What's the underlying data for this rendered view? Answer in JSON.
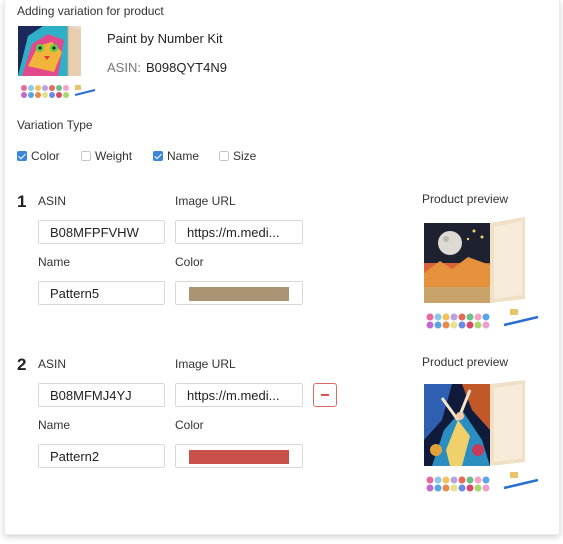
{
  "header": {
    "title": "Adding variation for product",
    "product_name": "Paint by Number Kit",
    "asin_label": "ASIN:",
    "asin_value": "B098QYT4N9",
    "image_icon": "cat-painting-thumbnail"
  },
  "variation_type": {
    "label": "Variation Type",
    "options": [
      {
        "label": "Color",
        "checked": true
      },
      {
        "label": "Weight",
        "checked": false
      },
      {
        "label": "Name",
        "checked": true
      },
      {
        "label": "Size",
        "checked": false
      }
    ]
  },
  "labels": {
    "asin": "ASIN",
    "image_url": "Image URL",
    "name": "Name",
    "color": "Color",
    "product_preview": "Product preview"
  },
  "variations": [
    {
      "number": "1",
      "asin": "B08MFPFVHW",
      "image_url": "https://m.medi...",
      "name": "Pattern5",
      "color_hex": "#ab9474",
      "preview_icon": "moon-landscape-canvas-preview"
    },
    {
      "number": "2",
      "asin": "B08MFMJ4YJ",
      "image_url": "https://m.medi...",
      "name": "Pattern2",
      "color_hex": "#c9514c",
      "preview_icon": "dancer-canvas-preview"
    }
  ],
  "colors": {
    "accent": "#3a86d9",
    "danger": "#d9534f"
  }
}
